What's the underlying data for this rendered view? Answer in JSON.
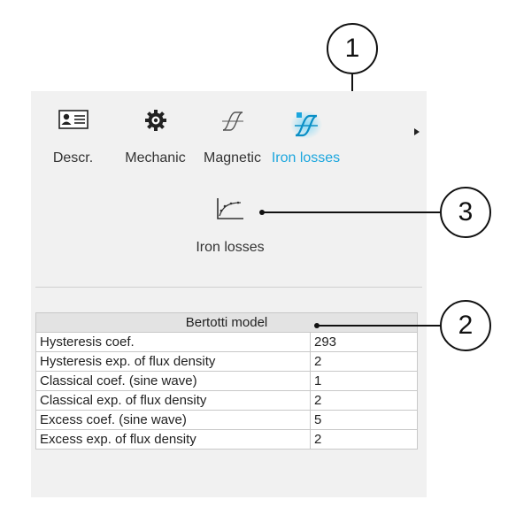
{
  "tabs": [
    {
      "label": "Descr.",
      "icon": "id-card-icon",
      "active": false
    },
    {
      "label": "Mechanic",
      "icon": "gear-icon",
      "active": false
    },
    {
      "label": "Magnetic",
      "icon": "hysteresis-icon",
      "active": false
    },
    {
      "label": "Iron losses",
      "icon": "iron-losses-hysteresis-icon",
      "active": true
    }
  ],
  "subtool": {
    "label": "Iron losses",
    "icon": "loss-curve-icon"
  },
  "table": {
    "header": "Bertotti model",
    "rows": [
      {
        "name": "Hysteresis coef.",
        "value": "293"
      },
      {
        "name": "Hysteresis exp. of flux density",
        "value": "2"
      },
      {
        "name": "Classical coef. (sine wave)",
        "value": "1"
      },
      {
        "name": "Classical exp. of flux density",
        "value": "2"
      },
      {
        "name": "Excess coef. (sine wave)",
        "value": "5"
      },
      {
        "name": "Excess exp. of flux density",
        "value": "2"
      }
    ]
  },
  "callouts": [
    "1",
    "2",
    "3"
  ],
  "colors": {
    "accent": "#1ba6de",
    "panel": "#f1f1f1"
  }
}
